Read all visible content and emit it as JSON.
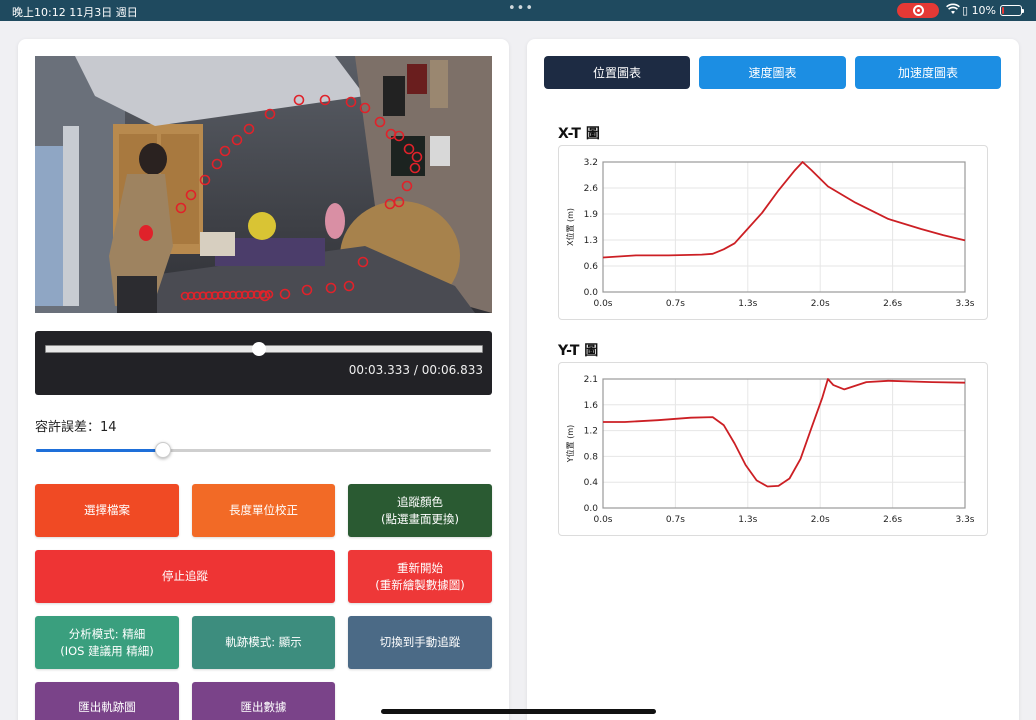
{
  "status_bar": {
    "time": "晚上10:12   11月3日 週日",
    "dots": "•••",
    "battery": "10%",
    "battery_level": 0.1,
    "rec_color": "#e53935"
  },
  "video_player": {
    "position": 0.488,
    "timecode": "00:03.333 / 00:06.833"
  },
  "tolerance": {
    "label": "容許誤差：14",
    "value": 14,
    "min": 0,
    "max": 50
  },
  "buttons": {
    "select_file": "選擇檔案",
    "calibrate": "長度單位校正",
    "track_color": "追蹤顏色\n(點選畫面更換)",
    "stop": "停止追蹤",
    "restart": "重新開始\n(重新繪製數據圖)",
    "analysis_mode": "分析模式: 精細\n(IOS 建議用 精細)",
    "trail_mode": "軌跡模式: 顯示",
    "manual": "切換到手動追蹤",
    "export_trail": "匯出軌跡圖",
    "export_data": "匯出數據"
  },
  "colors": {
    "select_file": "#f04a24",
    "calibrate": "#f26a26",
    "track_color": "#2a5a32",
    "stop": "#ee3434",
    "restart": "#ee3838",
    "analysis_mode": "#3a9f7e",
    "trail_mode": "#3d8d7e",
    "manual": "#4b6a86",
    "export": "#7a4389",
    "tab_active": "#1d2b43",
    "tab": "#1c8ee3",
    "series": "#cc1f24"
  },
  "tabs": [
    {
      "label": "位置圖表",
      "active": true
    },
    {
      "label": "速度圖表",
      "active": false
    },
    {
      "label": "加速度圖表",
      "active": false
    }
  ],
  "chart_data": [
    {
      "type": "line",
      "title": "X-T 圖",
      "ylabel": "X位置 (m)",
      "xlabel": "",
      "xlim": [
        0,
        3.3
      ],
      "ylim": [
        0,
        3.2
      ],
      "xticks": [
        "0.0s",
        "0.7s",
        "1.3s",
        "2.0s",
        "2.6s",
        "3.3s"
      ],
      "yticks": [
        "0.0",
        "0.6",
        "1.3",
        "1.9",
        "2.6",
        "3.2"
      ],
      "grid": true,
      "x": [
        0.0,
        0.3,
        0.6,
        0.9,
        1.0,
        1.1,
        1.2,
        1.3,
        1.45,
        1.6,
        1.75,
        1.82,
        1.9,
        2.05,
        2.3,
        2.6,
        2.9,
        3.1,
        3.3
      ],
      "y": [
        0.85,
        0.9,
        0.9,
        0.92,
        0.94,
        1.05,
        1.2,
        1.5,
        1.95,
        2.5,
        3.0,
        3.2,
        3.0,
        2.6,
        2.2,
        1.8,
        1.55,
        1.4,
        1.27
      ]
    },
    {
      "type": "line",
      "title": "Y-T 圖",
      "ylabel": "Y位置 (m)",
      "xlabel": "",
      "xlim": [
        0,
        3.3
      ],
      "ylim": [
        0,
        2.1
      ],
      "xticks": [
        "0.0s",
        "0.7s",
        "1.3s",
        "2.0s",
        "2.6s",
        "3.3s"
      ],
      "yticks": [
        "0.0",
        "0.4",
        "0.8",
        "1.2",
        "1.6",
        "2.1"
      ],
      "grid": true,
      "x": [
        0.0,
        0.2,
        0.5,
        0.8,
        1.0,
        1.1,
        1.2,
        1.3,
        1.4,
        1.5,
        1.6,
        1.7,
        1.8,
        1.9,
        2.0,
        2.05,
        2.1,
        2.2,
        2.4,
        2.6,
        3.0,
        3.3
      ],
      "y": [
        1.4,
        1.4,
        1.43,
        1.47,
        1.48,
        1.35,
        1.05,
        0.7,
        0.45,
        0.35,
        0.36,
        0.48,
        0.8,
        1.3,
        1.8,
        2.1,
        2.0,
        1.93,
        2.05,
        2.07,
        2.05,
        2.04
      ]
    }
  ]
}
